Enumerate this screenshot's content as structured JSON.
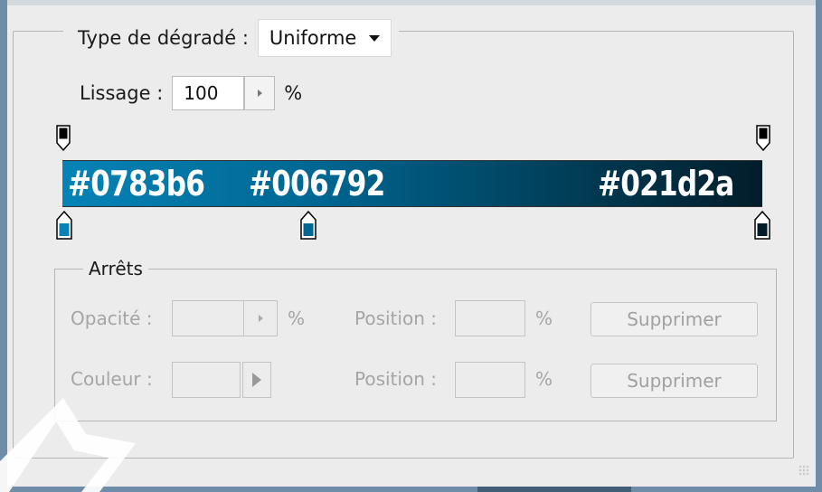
{
  "header": {
    "gradient_type_label": "Type de dégradé :",
    "gradient_type_value": "Uniforme"
  },
  "smoothing": {
    "label": "Lissage :",
    "value": "100",
    "unit": "%"
  },
  "gradient": {
    "colors": [
      "#0783b6",
      "#006792",
      "#021d2a"
    ],
    "labels": [
      "#0783b6",
      "#006792",
      "#021d2a"
    ],
    "opacity_stops": [
      {
        "position": 0,
        "color": "#000000"
      },
      {
        "position": 100,
        "color": "#000000"
      }
    ],
    "color_stops": [
      {
        "position": 0,
        "color": "#0783b6"
      },
      {
        "position": 36,
        "color": "#006792"
      },
      {
        "position": 100,
        "color": "#021d2a"
      }
    ]
  },
  "stops_group": {
    "title": "Arrêts",
    "opacity_label": "Opacité :",
    "opacity_unit": "%",
    "color_label": "Couleur :",
    "position_label": "Position :",
    "position_unit": "%",
    "delete_label": "Supprimer"
  },
  "icons": {
    "dropdown": "caret-down-icon",
    "stepper": "triangle-right-icon",
    "opacity_stop": "opacity-stop-icon",
    "color_stop": "color-stop-icon",
    "resize": "resize-grip-icon"
  }
}
